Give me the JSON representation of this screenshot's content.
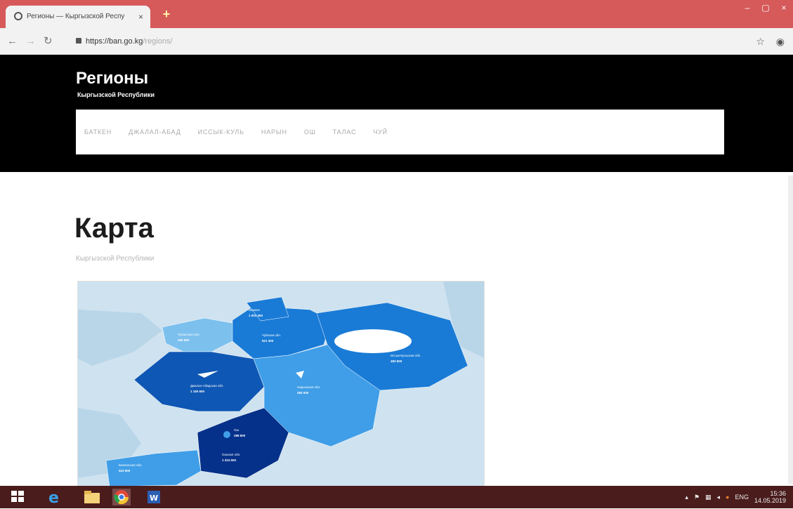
{
  "browser": {
    "tab_title": "Регионы — Кыргызской Респу",
    "tab_close": "×",
    "new_tab": "+",
    "url_host": "https://ban.go.kg",
    "url_path": "/regions/",
    "window_controls": [
      "–",
      "▢",
      "×"
    ]
  },
  "header": {
    "title": "Регионы",
    "subtitle": "Кыргызской Республики",
    "nav": [
      "БАТКЕН",
      "ДЖАЛАЛ-АБАД",
      "ИССЫК-КУЛЬ",
      "НАРЫН",
      "ОШ",
      "ТАЛАС",
      "ЧУЙ"
    ]
  },
  "main": {
    "title": "Карта",
    "subtitle": "Кыргызской Республики"
  },
  "map": {
    "regions": [
      {
        "name": "Бишкек",
        "value": "1 003 300"
      },
      {
        "name": "Таласская обл.",
        "value": "255 800"
      },
      {
        "name": "Чуйская обл.",
        "value": "921 300"
      },
      {
        "name": "Иссык-Кульская обл.",
        "value": "483 600"
      },
      {
        "name": "Джалал-Абадская обл.",
        "value": "1 150 600"
      },
      {
        "name": "Нарынская обл.",
        "value": "283 000"
      },
      {
        "name": "Ош",
        "value": "288 800"
      },
      {
        "name": "Ошская обл.",
        "value": "1 324 500"
      },
      {
        "name": "Баткенская обл.",
        "value": "523 900"
      }
    ],
    "colors": {
      "background": "#cfe2ef",
      "outer_land": "#b9d6e9",
      "light": "#7cc0ee",
      "medium": "#3f9ee7",
      "strong": "#1a7bd6",
      "deep": "#0f57b4",
      "darkest": "#06318a",
      "lake": "#ffffff"
    }
  },
  "taskbar": {
    "lang": "ENG",
    "time": "15:36",
    "date": "14.05.2019"
  }
}
